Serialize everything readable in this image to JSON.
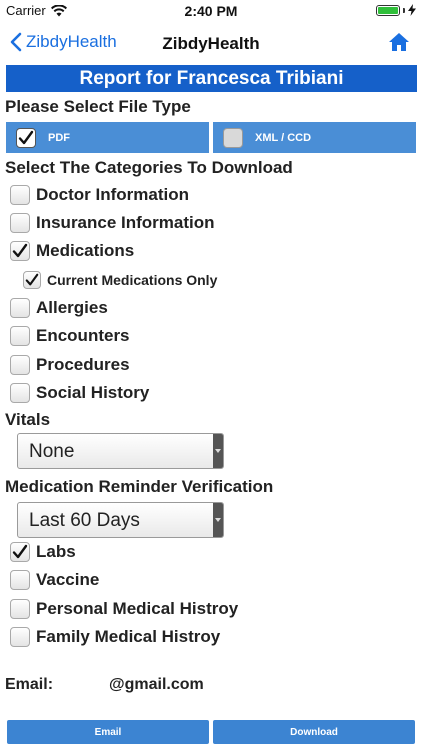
{
  "status_bar": {
    "carrier": "Carrier",
    "time": "2:40 PM"
  },
  "nav": {
    "back_label": "ZibdyHealth",
    "title": "ZibdyHealth"
  },
  "report": {
    "title": "Report for Francesca Tribiani"
  },
  "file_type": {
    "heading": "Please Select File Type",
    "options": [
      {
        "label": "PDF",
        "checked": true
      },
      {
        "label": "XML / CCD",
        "checked": false
      }
    ]
  },
  "categories": {
    "heading": "Select The Categories To Download",
    "items": [
      {
        "label": "Doctor Information",
        "checked": false
      },
      {
        "label": "Insurance Information",
        "checked": false
      },
      {
        "label": "Medications",
        "checked": true
      },
      {
        "label": "Current Medications Only",
        "checked": true
      },
      {
        "label": "Allergies",
        "checked": false
      },
      {
        "label": "Encounters",
        "checked": false
      },
      {
        "label": "Procedures",
        "checked": false
      },
      {
        "label": "Social History",
        "checked": false
      }
    ]
  },
  "vitals": {
    "heading": "Vitals",
    "selected": "None"
  },
  "medication_reminder": {
    "heading": "Medication Reminder Verification",
    "selected": "Last 60 Days"
  },
  "more_categories": {
    "items": [
      {
        "label": "Labs",
        "checked": true
      },
      {
        "label": "Vaccine",
        "checked": false
      },
      {
        "label": "Personal Medical Histroy",
        "checked": false
      },
      {
        "label": "Family Medical Histroy",
        "checked": false
      }
    ]
  },
  "email": {
    "label": "Email:",
    "value": "@gmail.com"
  },
  "buttons": {
    "email": "Email",
    "download": "Download"
  },
  "colors": {
    "accent": "#1a6fe0",
    "banner": "#1560c9",
    "file_type_bg": "#4a8ed6",
    "button": "#3c84d2"
  }
}
